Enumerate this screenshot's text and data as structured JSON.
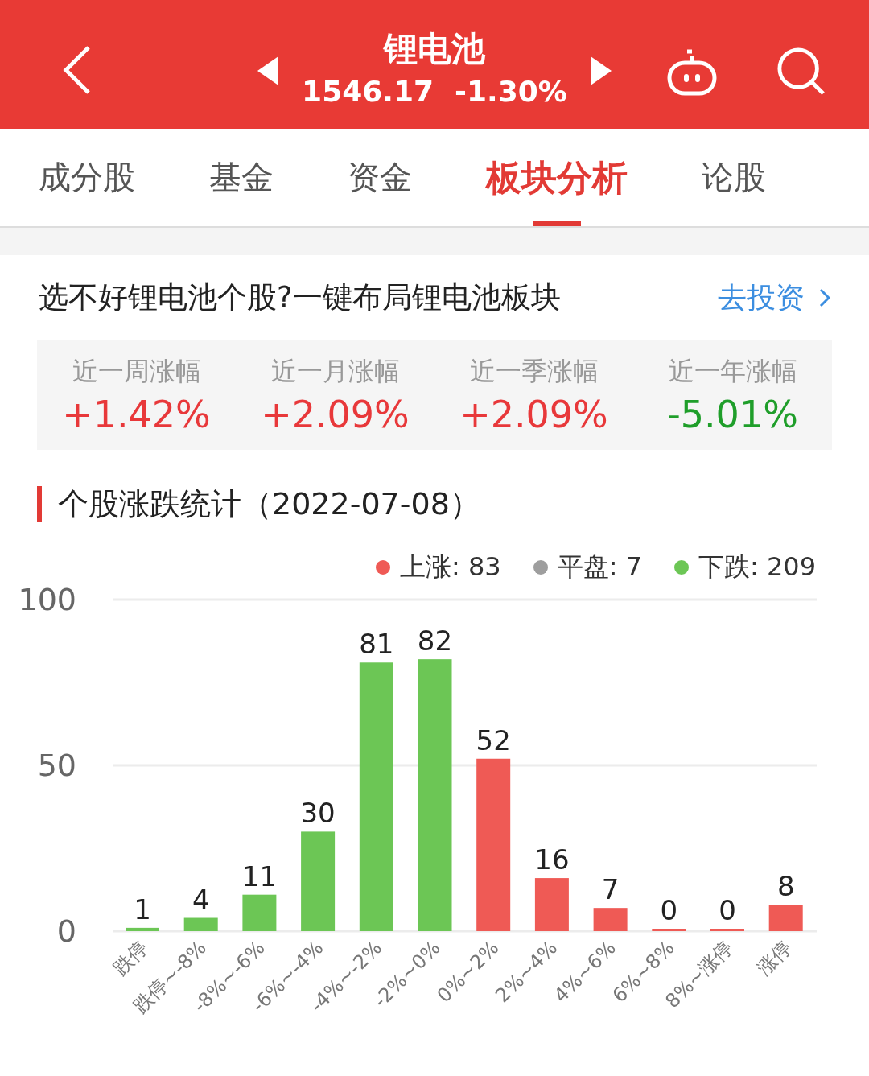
{
  "header": {
    "title": "锂电池",
    "price": "1546.17",
    "change": "-1.30%"
  },
  "tabs": [
    {
      "label": "成分股",
      "selected": false
    },
    {
      "label": "基金",
      "selected": false
    },
    {
      "label": "资金",
      "selected": false
    },
    {
      "label": "板块分析",
      "selected": true
    },
    {
      "label": "论股",
      "selected": false
    }
  ],
  "promo": {
    "text": "选不好锂电池个股?一键布局锂电池板块",
    "link": "去投资"
  },
  "returns": [
    {
      "label": "近一周涨幅",
      "value": "+1.42%",
      "kind": "up"
    },
    {
      "label": "近一月涨幅",
      "value": "+2.09%",
      "kind": "up"
    },
    {
      "label": "近一季涨幅",
      "value": "+2.09%",
      "kind": "up"
    },
    {
      "label": "近一年涨幅",
      "value": "-5.01%",
      "kind": "down"
    }
  ],
  "stats": {
    "title": "个股涨跌统计（2022-07-08）",
    "legend": [
      {
        "label": "上涨: 83",
        "color": "#ef5a55"
      },
      {
        "label": "平盘: 7",
        "color": "#9e9e9e"
      },
      {
        "label": "下跌: 209",
        "color": "#6cc655"
      }
    ],
    "chart_data": {
      "type": "bar",
      "categories": [
        "跌停",
        "跌停~-8%",
        "-8%~-6%",
        "-6%~-4%",
        "-4%~-2%",
        "-2%~0%",
        "0%~2%",
        "2%~4%",
        "4%~6%",
        "6%~8%",
        "8%~涨停",
        "涨停"
      ],
      "series": [
        {
          "color": "#6cc655",
          "values": [
            1,
            4,
            11,
            30,
            81,
            82,
            null,
            null,
            null,
            null,
            null,
            null
          ]
        },
        {
          "color": "#ef5a55",
          "values": [
            null,
            null,
            null,
            null,
            null,
            null,
            52,
            16,
            7,
            0,
            0,
            8
          ]
        }
      ],
      "ylim": [
        0,
        100
      ],
      "yticks": [
        0,
        50,
        100
      ],
      "data_labels": true
    }
  }
}
